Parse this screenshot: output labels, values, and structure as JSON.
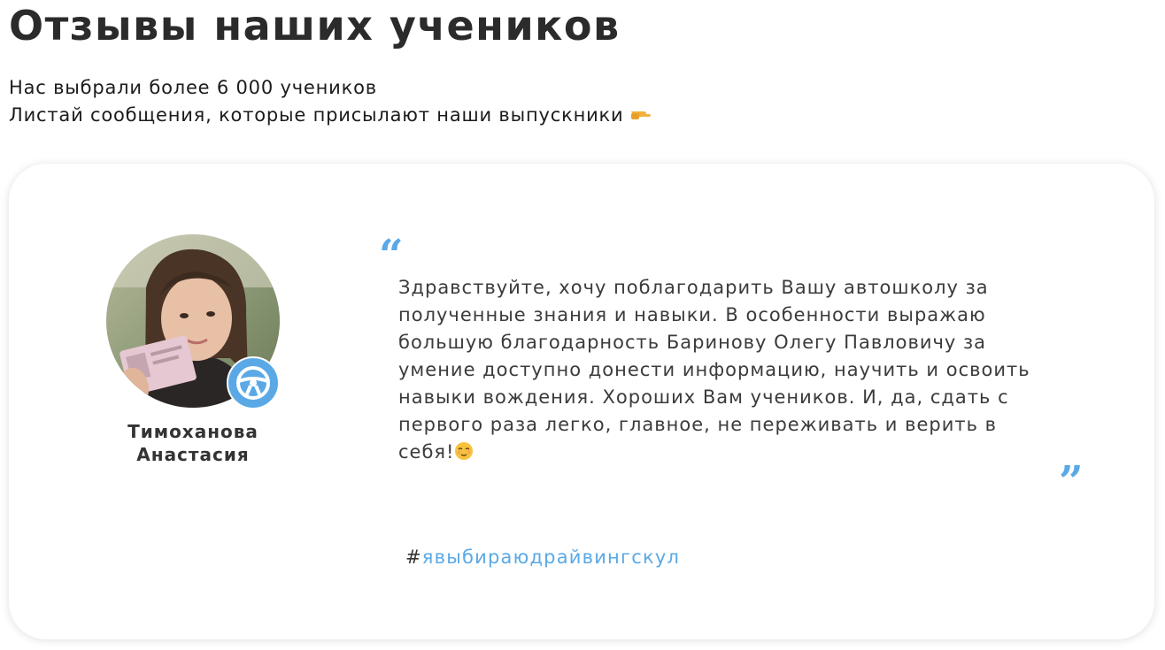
{
  "heading": {
    "title": "Отзывы наших учеников",
    "subtitle_line1": "Нас выбрали более 6 000 учеников",
    "subtitle_line2": "Листай сообщения, которые присылают наши выпускники",
    "subtitle_icon": "pointing-hand-icon"
  },
  "review": {
    "author_first_line": "Тимоханова",
    "author_second_line": "Анастасия",
    "avatar_icon": "student-photo",
    "badge_icon": "steering-wheel-icon",
    "quote_open": "“",
    "quote_close": "”",
    "text_lines": [
      "Здравствуйте, хочу поблагодарить Вашу автошколу за",
      "полученные знания и навыки. В особенности выражаю",
      "большую благодарность Баринову Олегу Павловичу за",
      "умение доступно донести информацию, научить и освоить",
      "навыки вождения. Хороших Вам учеников. И, да, сдать с",
      "первого раза легко, главное, не переживать и верить в",
      "себя!"
    ],
    "text_end_icon": "relieved-face-icon",
    "hashtag_symbol": "#",
    "hashtag_text": "явыбираюдрайвингскул"
  },
  "colors": {
    "accent": "#5aa9e6",
    "text": "#3b3b3b",
    "title": "#2b2b2b"
  }
}
